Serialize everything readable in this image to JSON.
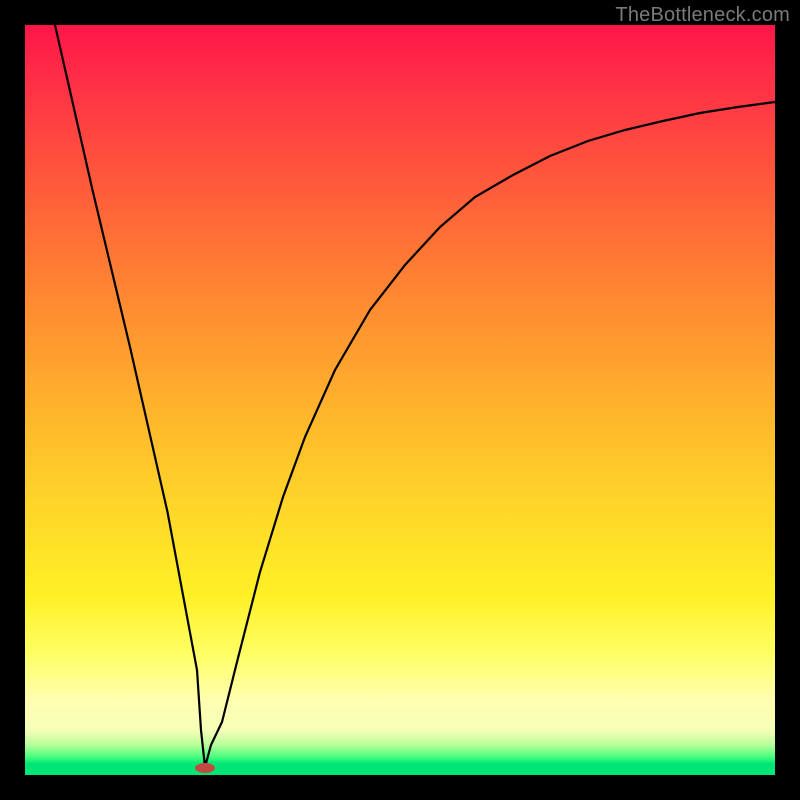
{
  "watermark": "TheBottleneck.com",
  "chart_data": {
    "type": "line",
    "title": "",
    "xlabel": "",
    "ylabel": "",
    "xlim": [
      0,
      100
    ],
    "ylim": [
      0,
      100
    ],
    "curve_note": "Bottleneck curve: steep linear drop from top-left to a minimum near x≈23, then a saturating rise toward top-right.",
    "x": [
      0,
      5,
      10,
      15,
      20,
      22,
      23,
      24,
      25,
      27,
      30,
      33,
      36,
      40,
      45,
      50,
      55,
      60,
      65,
      70,
      75,
      80,
      85,
      90,
      95,
      100
    ],
    "y": [
      100,
      78,
      57,
      35,
      14,
      5,
      1,
      3,
      7,
      15,
      27,
      37,
      45,
      54,
      62,
      68,
      73,
      77,
      80,
      82.5,
      84.5,
      86,
      87.2,
      88.2,
      89,
      89.7
    ],
    "minimum_marker": {
      "x": 23,
      "y": 1
    },
    "background_gradient": {
      "top": "#ff1649",
      "mid_upper": "#ff9330",
      "mid_lower": "#ffff66",
      "bottom": "#00e676"
    }
  }
}
